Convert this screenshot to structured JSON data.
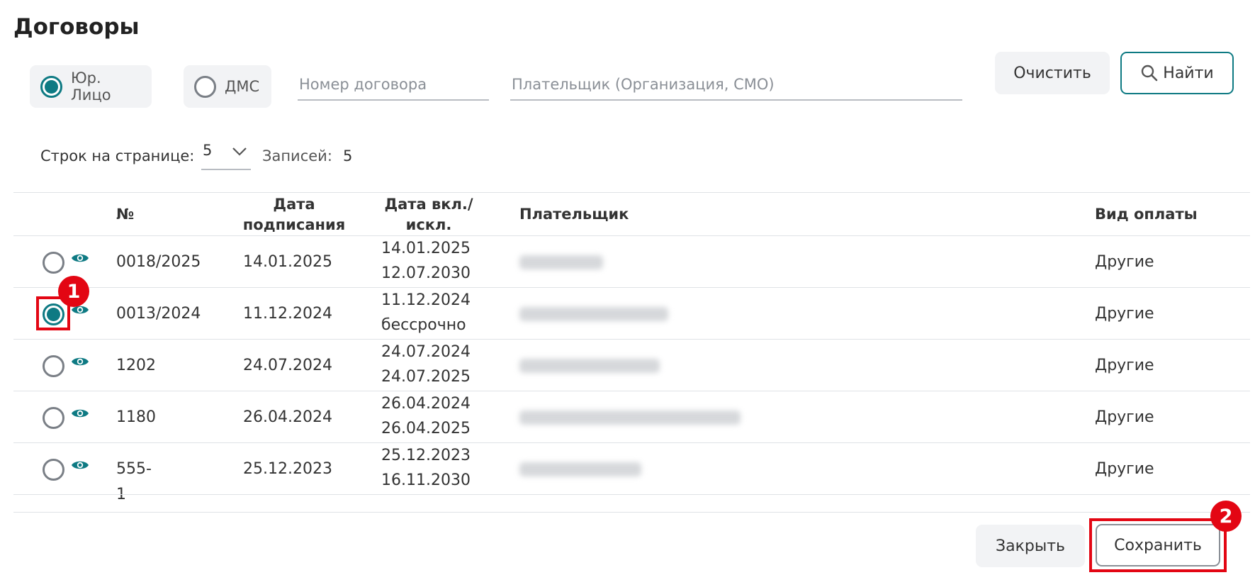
{
  "page": {
    "title": "Договоры"
  },
  "filters": {
    "type_options": [
      {
        "label": "Юр. Лицо",
        "selected": true
      },
      {
        "label": "ДМС",
        "selected": false
      }
    ],
    "contract_number_placeholder": "Номер договора",
    "payer_placeholder": "Плательщик (Организация, СМО)",
    "clear_label": "Очистить",
    "search_label": "Найти"
  },
  "pagination": {
    "rows_label": "Строк на странице:",
    "rows_value": "5",
    "records_label": "Записей:",
    "records_value": "5"
  },
  "table": {
    "headers": {
      "number": "№",
      "sign_date_line1": "Дата",
      "sign_date_line2": "подписания",
      "incl_line1": "Дата вкл./",
      "incl_line2": "искл.",
      "payer": "Плательщик",
      "payment_type": "Вид оплаты"
    },
    "rows": [
      {
        "selected": false,
        "number": "0018/2025",
        "sign_date": "14.01.2025",
        "incl_date": "14.01.2025",
        "excl_date": "12.07.2030",
        "payment_type": "Другие"
      },
      {
        "selected": true,
        "number": "0013/2024",
        "sign_date": "11.12.2024",
        "incl_date": "11.12.2024",
        "excl_date": "бессрочно",
        "payment_type": "Другие"
      },
      {
        "selected": false,
        "number": "1202",
        "sign_date": "24.07.2024",
        "incl_date": "24.07.2024",
        "excl_date": "24.07.2025",
        "payment_type": "Другие"
      },
      {
        "selected": false,
        "number": "1180",
        "sign_date": "26.04.2024",
        "incl_date": "26.04.2024",
        "excl_date": "26.04.2025",
        "payment_type": "Другие"
      },
      {
        "selected": false,
        "number": "555-1",
        "sign_date": "25.12.2023",
        "incl_date": "25.12.2023",
        "excl_date": "16.11.2030",
        "payment_type": "Другие"
      }
    ]
  },
  "footer": {
    "close_label": "Закрыть",
    "save_label": "Сохранить"
  },
  "annotations": {
    "badge_1": "1",
    "badge_2": "2"
  },
  "icons": {
    "search": "search-icon",
    "view": "eye-icon",
    "dropdown": "chevron-down-icon"
  },
  "colors": {
    "accent": "#0e7a83",
    "annotation": "#e30613",
    "button_bg": "#f2f3f5"
  }
}
